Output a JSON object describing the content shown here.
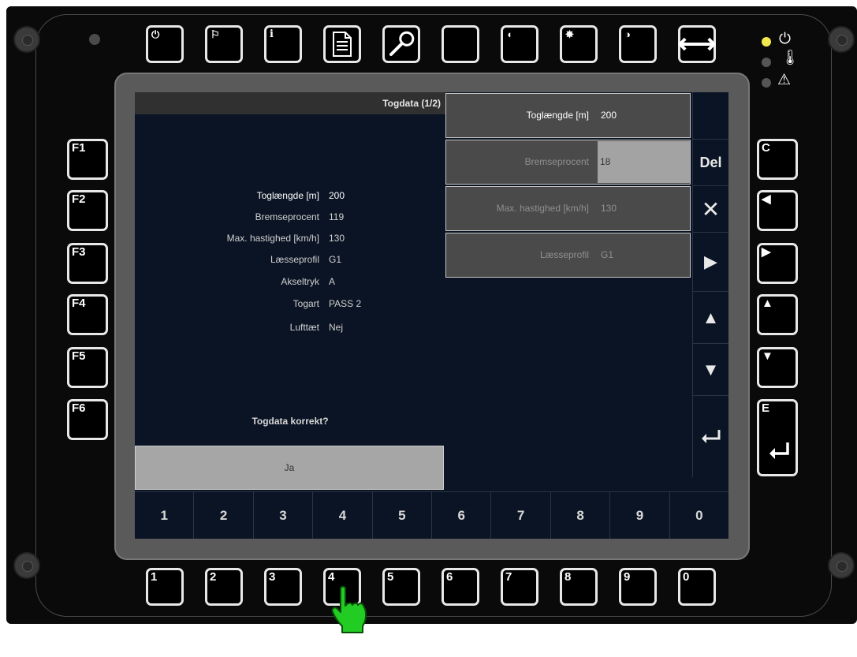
{
  "top_buttons": [
    {
      "icon": "power-icon",
      "glyph": "⏻"
    },
    {
      "icon": "flag-icon",
      "glyph": "⚐"
    },
    {
      "icon": "info-icon",
      "glyph": "i"
    },
    {
      "icon": "document-icon",
      "glyph": "▤"
    },
    {
      "icon": "wrench-icon",
      "glyph": "🔧"
    },
    {
      "icon": "blank-icon",
      "glyph": ""
    },
    {
      "icon": "speaker-icon",
      "glyph": "◖"
    },
    {
      "icon": "brightness-icon",
      "glyph": "✸"
    },
    {
      "icon": "contrast-icon",
      "glyph": "◑"
    },
    {
      "icon": "width-arrows-icon",
      "glyph": "⟷"
    }
  ],
  "left_buttons": [
    "F1",
    "F2",
    "F3",
    "F4",
    "F5",
    "F6"
  ],
  "right_buttons": [
    {
      "label": "C",
      "icon": "clear-icon"
    },
    {
      "label": "◀",
      "icon": "left-arrow-icon"
    },
    {
      "label": "▶",
      "icon": "right-arrow-icon"
    },
    {
      "label": "▲",
      "icon": "up-arrow-icon"
    },
    {
      "label": "▼",
      "icon": "down-arrow-icon"
    },
    {
      "label": "E",
      "icon": "enter-icon"
    }
  ],
  "bottom_buttons": [
    "1",
    "2",
    "3",
    "4",
    "5",
    "6",
    "7",
    "8",
    "9",
    "0"
  ],
  "status_leds": [
    {
      "color": "#f2e94e",
      "icon": "power-icon",
      "glyph": "⏻"
    },
    {
      "color": "#555555",
      "icon": "temperature-icon",
      "glyph": "🌡"
    },
    {
      "color": "#555555",
      "icon": "warning-icon",
      "glyph": "⚠"
    }
  ],
  "screen": {
    "title": "Togdata (1/2)",
    "info_rows": [
      {
        "label": "Toglængde [m]",
        "value": "200"
      },
      {
        "label": "Bremseprocent",
        "value": "119"
      },
      {
        "label": "Max. hastighed [km/h]",
        "value": "130"
      },
      {
        "label": "Læsseprofil",
        "value": "G1"
      },
      {
        "label": "Akseltryk",
        "value": "A"
      },
      {
        "label": "Togart",
        "value": "PASS 2"
      },
      {
        "label": "Lufttæt",
        "value": "Nej"
      }
    ],
    "question": "Togdata korrekt?",
    "confirm_label": "Ja",
    "fields": [
      {
        "label": "Toglængde [m]",
        "value": "200"
      },
      {
        "label": "Bremseprocent",
        "value": "18"
      },
      {
        "label": "Max. hastighed [km/h]",
        "value": "130"
      },
      {
        "label": "Læsseprofil",
        "value": "G1"
      }
    ],
    "side_keys": {
      "del": "Del",
      "cancel": "✕",
      "right": "▶",
      "up": "▲",
      "down": "▼",
      "enter": "↵"
    },
    "number_keys": [
      "1",
      "2",
      "3",
      "4",
      "5",
      "6",
      "7",
      "8",
      "9",
      "0"
    ]
  },
  "pointer": {
    "icon": "hand-pointer-icon",
    "color": "#22cc22",
    "target": "4"
  }
}
